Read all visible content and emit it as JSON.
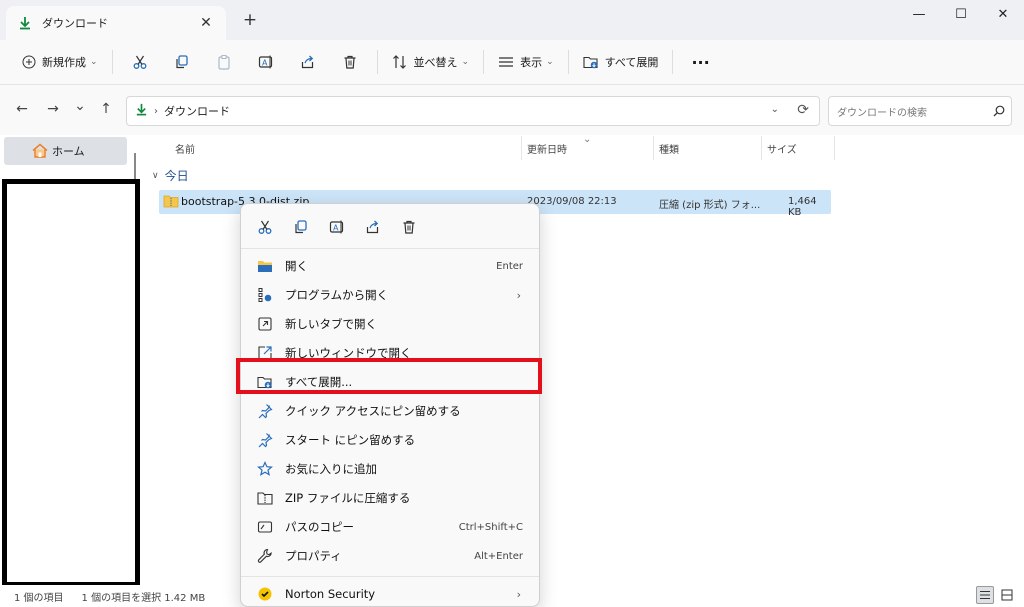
{
  "tab": {
    "title": "ダウンロード",
    "close": "✕",
    "new_tab": "+"
  },
  "window_controls": {
    "minimize": "—",
    "maximize": "☐",
    "close": "✕"
  },
  "commandbar": {
    "new_label": "新規作成",
    "sort_label": "並べ替え",
    "view_label": "表示",
    "extract_all_label": "すべて展開",
    "more_label": "···"
  },
  "navigation": {
    "back": "←",
    "forward": "→",
    "recent": "⌄",
    "up": "↑"
  },
  "address": {
    "location": "ダウンロード",
    "separator": "›"
  },
  "search": {
    "placeholder": "ダウンロードの検索"
  },
  "sidebar": {
    "home_label": "ホーム"
  },
  "columns": {
    "name": "名前",
    "modified": "更新日時",
    "type": "種類",
    "size": "サイズ"
  },
  "group": {
    "label": "今日"
  },
  "file": {
    "name": "bootstrap-5.3.0-dist.zip",
    "modified": "2023/09/08 22:13",
    "type": "圧縮 (zip 形式) フォ...",
    "size": "1,464 KB"
  },
  "context_menu": {
    "items": [
      {
        "label": "開く",
        "accel": "Enter"
      },
      {
        "label": "プログラムから開く",
        "submenu": "›"
      },
      {
        "label": "新しいタブで開く"
      },
      {
        "label": "新しいウィンドウで開く"
      },
      {
        "label": "すべて展開..."
      },
      {
        "label": "クイック アクセスにピン留めする"
      },
      {
        "label": "スタート にピン留めする"
      },
      {
        "label": "お気に入りに追加"
      },
      {
        "label": "ZIP ファイルに圧縮する"
      },
      {
        "label": "パスのコピー",
        "accel": "Ctrl+Shift+C"
      },
      {
        "label": "プロパティ",
        "accel": "Alt+Enter"
      },
      {
        "label": "Norton Security",
        "submenu": "›"
      }
    ]
  },
  "status": {
    "item_count": "1 個の項目",
    "selected": "1 個の項目を選択 1.42 MB"
  },
  "colors": {
    "accent": "#0f7b0f",
    "selection": "#cce4f7",
    "highlight_border": "#e3101c",
    "folder_yellow": "#f4c64a"
  }
}
